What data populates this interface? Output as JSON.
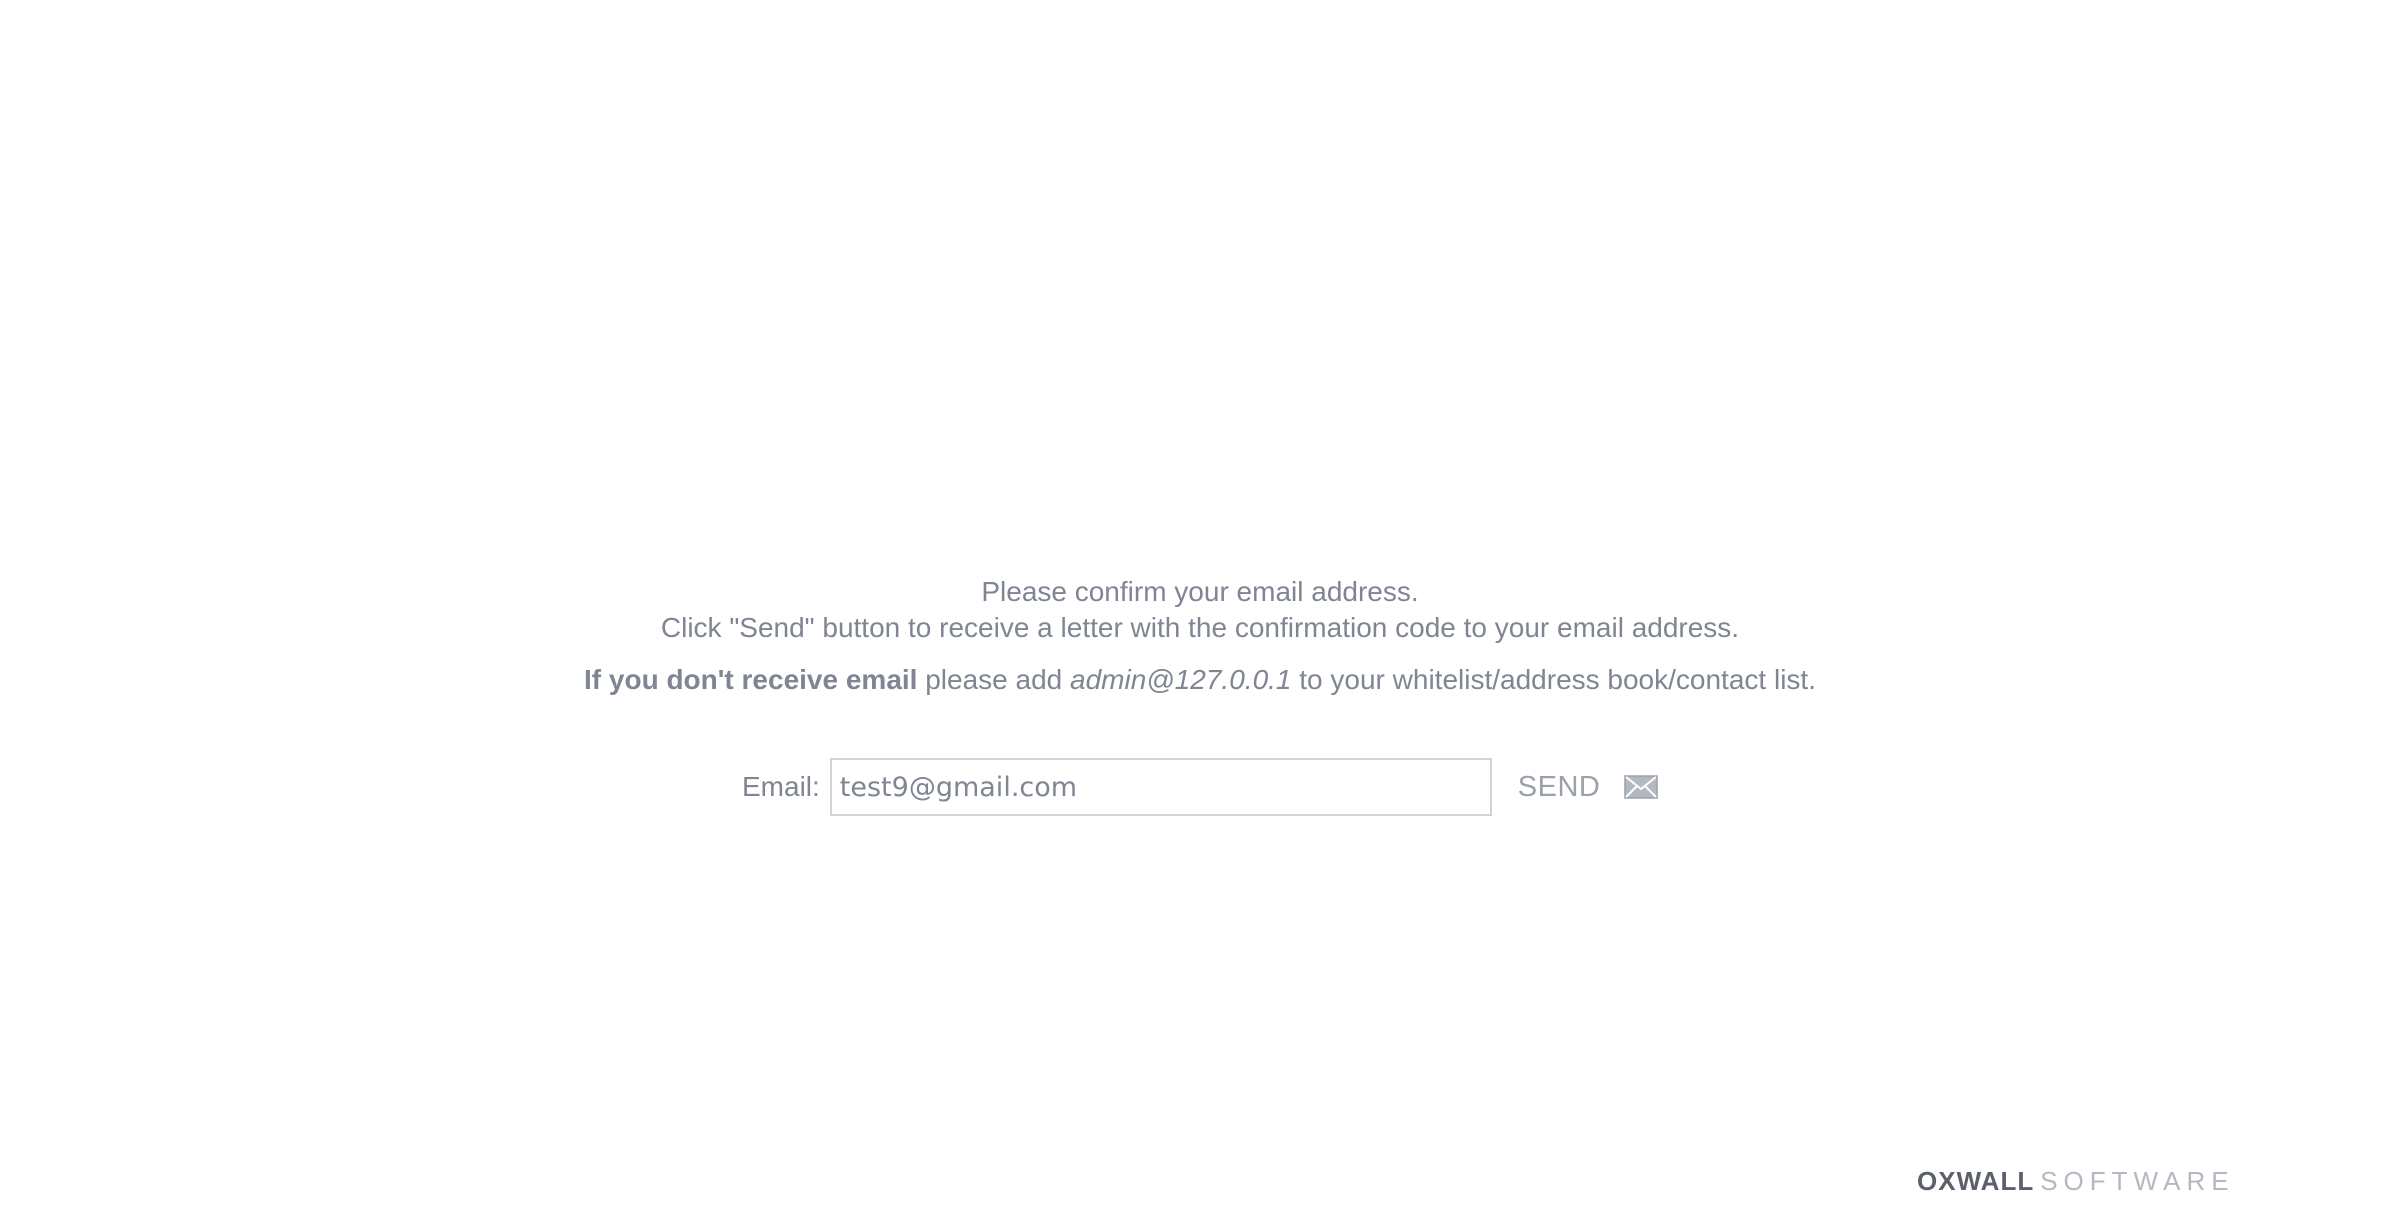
{
  "message": {
    "line1": "Please confirm your email address.",
    "line2": "Click \"Send\" button to receive a letter with the confirmation code to your email address.",
    "line3_bold": "If you don't receive email",
    "line3_mid": " please add ",
    "line3_email": "admin@127.0.0.1",
    "line3_end": " to your whitelist/address book/contact list."
  },
  "form": {
    "email_label": "Email:",
    "email_value": "test9@gmail.com",
    "send_label": "SEND",
    "send_icon": "envelope-icon"
  },
  "footer": {
    "brand_bold": "OXWALL",
    "brand_light": "SOFTWARE"
  },
  "colors": {
    "text": "#7f8592",
    "input_border": "#cfd3da",
    "send": "#9ba1ab",
    "brand_dark": "#5b606b",
    "brand_light": "#b3b8c1"
  }
}
